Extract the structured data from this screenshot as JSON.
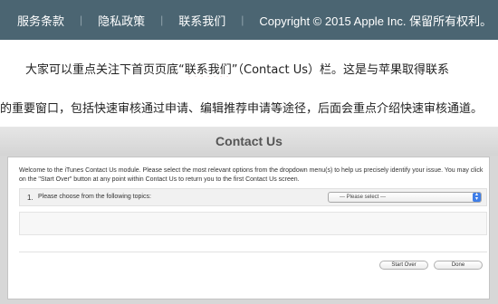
{
  "topbar": {
    "links": [
      "服务条款",
      "隐私政策",
      "联系我们"
    ],
    "separator": "|",
    "copyright": "Copyright © 2015 Apple Inc. 保留所有权利。"
  },
  "article": {
    "line1_before": "大家可以重点关注下首页页底“",
    "line1_underlined": "联系我们",
    "line1_after": "”（Contact Us）栏。这是与苹果取得联系",
    "line2": "的重要窗口，包括快速审核通过申请、编辑推荐申请等途径，后面会重点介绍快速审核通道。"
  },
  "contact_module": {
    "title": "Contact Us",
    "welcome_text": "Welcome to the iTunes Contact Us module. Please select the most relevant options from the dropdown menu(s) to help us precisely identify your issue. You may click on the \"Start Over\" button at any point within Contact Us to return you to the first Contact Us screen.",
    "topic_number": "1.",
    "topic_label": "Please choose from the following topics:",
    "select_value": "--- Please select ---",
    "start_over_label": "Start Over",
    "done_label": "Done"
  },
  "colors": {
    "topbar_bg": "#4b6572",
    "select_accent": "#3f7ee8",
    "spellcheck_underline": "#d23c3c"
  }
}
